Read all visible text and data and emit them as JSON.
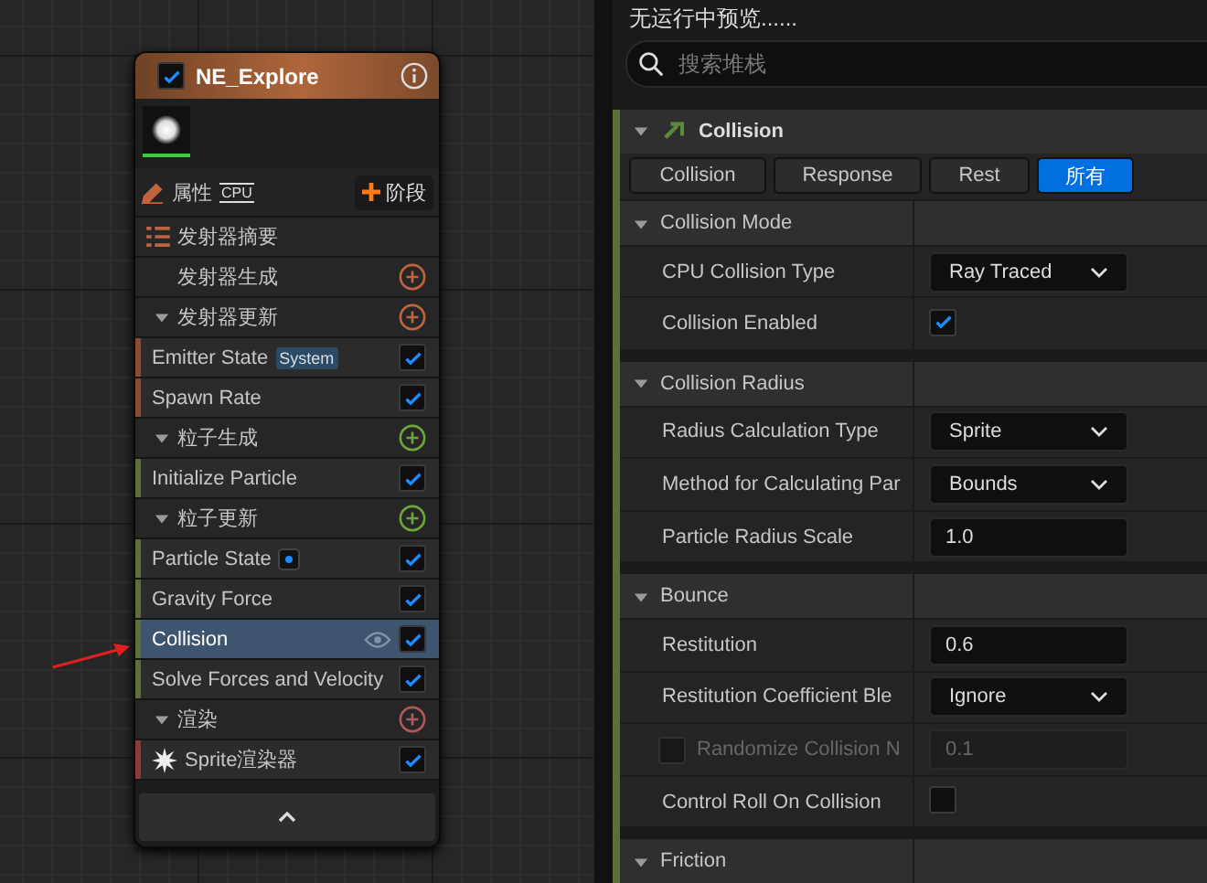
{
  "node": {
    "title": "NE_Explore",
    "enabled": true,
    "properties_label": "属性",
    "sim_target": "CPU",
    "add_stage_button": "阶段",
    "summary": "发射器摘要",
    "items": [
      {
        "kind": "stage",
        "label": "发射器生成",
        "color": "#c0643c"
      },
      {
        "kind": "group",
        "label": "发射器更新",
        "color": "#c0643c"
      },
      {
        "kind": "module",
        "label": "Emitter State",
        "badge": "System",
        "color": "#8b4a2b",
        "enabled": true,
        "selected": false
      },
      {
        "kind": "module",
        "label": "Spawn Rate",
        "color": "#8b4a2b",
        "enabled": true,
        "selected": false
      },
      {
        "kind": "group",
        "label": "粒子生成",
        "color": "#6aa63a"
      },
      {
        "kind": "module",
        "label": "Initialize Particle",
        "color": "#5d6e38",
        "enabled": true,
        "selected": false
      },
      {
        "kind": "group",
        "label": "粒子更新",
        "color": "#6aa63a"
      },
      {
        "kind": "module-dot",
        "label": "Particle State",
        "color": "#5d6e38",
        "enabled": true,
        "selected": false
      },
      {
        "kind": "module",
        "label": "Gravity Force",
        "color": "#5d6e38",
        "enabled": true,
        "selected": false
      },
      {
        "kind": "module",
        "label": "Collision",
        "color": "#5d6e38",
        "enabled": true,
        "selected": true
      },
      {
        "kind": "module",
        "label": "Solve Forces and Velocity",
        "color": "#5d6e38",
        "enabled": true,
        "selected": false
      },
      {
        "kind": "group",
        "label": "渲染",
        "color": "#b05858"
      },
      {
        "kind": "renderer",
        "label": "Sprite渲染器",
        "color": "#8b3a3a",
        "enabled": true,
        "selected": false
      }
    ]
  },
  "details": {
    "status": "无运行中预览......",
    "search": {
      "placeholder": "搜索堆栈"
    },
    "section": "Collision",
    "filters": [
      {
        "label": "Collision",
        "selected": false
      },
      {
        "label": "Response",
        "selected": false
      },
      {
        "label": "Rest",
        "selected": false
      },
      {
        "label": "所有",
        "selected": true
      }
    ],
    "categories": [
      {
        "name": "Collision Mode",
        "properties": [
          {
            "kind": "dropdown",
            "label": "CPU Collision Type",
            "value": "Ray Traced"
          },
          {
            "kind": "checkbox",
            "label": "Collision Enabled",
            "checked": true
          }
        ]
      },
      {
        "name": "Collision Radius",
        "properties": [
          {
            "kind": "dropdown",
            "label": "Radius Calculation Type",
            "value": "Sprite"
          },
          {
            "kind": "dropdown",
            "label": "Method for Calculating Par",
            "value": "Bounds"
          },
          {
            "kind": "number",
            "label": "Particle Radius Scale",
            "value": "1.0"
          }
        ]
      },
      {
        "name": "Bounce",
        "properties": [
          {
            "kind": "number",
            "label": "Restitution",
            "value": "0.6"
          },
          {
            "kind": "dropdown",
            "label": "Restitution Coefficient Ble",
            "value": "Ignore"
          },
          {
            "kind": "optional-number",
            "label": "Randomize Collision N",
            "value": "0.1",
            "checked": false
          },
          {
            "kind": "checkbox",
            "label": "Control Roll On Collision",
            "checked": false
          }
        ]
      },
      {
        "name": "Friction"
      }
    ]
  }
}
